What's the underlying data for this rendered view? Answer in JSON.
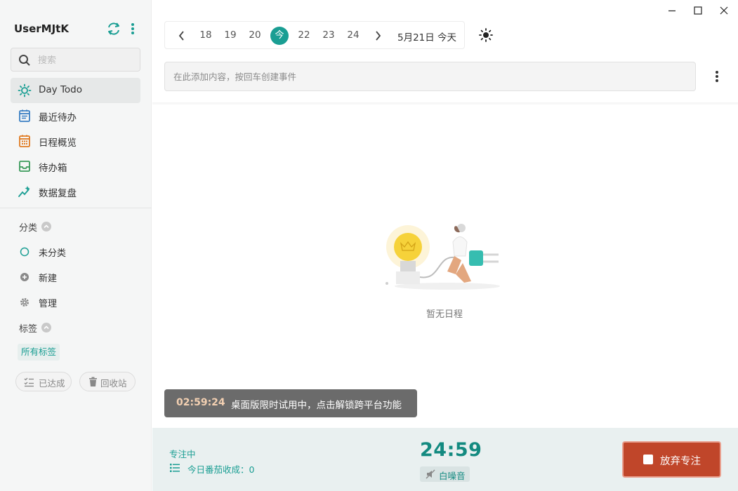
{
  "app": {
    "user_name": "UserMJtK"
  },
  "sidebar": {
    "search_placeholder": "搜索",
    "nav": [
      {
        "label": "Day Todo",
        "icon": "sun-icon",
        "active": true
      },
      {
        "label": "最近待办",
        "icon": "list-calendar-icon"
      },
      {
        "label": "日程概览",
        "icon": "calendar-grid-icon"
      },
      {
        "label": "待办箱",
        "icon": "inbox-icon"
      },
      {
        "label": "数据复盘",
        "icon": "sparkle-chart-icon"
      }
    ],
    "category_section": "分类",
    "categories": [
      {
        "label": "未分类",
        "icon": "circle-outline-icon"
      },
      {
        "label": "新建",
        "icon": "plus-circle-icon"
      },
      {
        "label": "管理",
        "icon": "gear-icon"
      }
    ],
    "tag_section": "标签",
    "all_tags": "所有标签",
    "done_button": "已达成",
    "trash_button": "回收站"
  },
  "date_bar": {
    "days": [
      "18",
      "19",
      "20",
      "22",
      "23",
      "24"
    ],
    "today_label": "今",
    "current_label": "5月21日 今天"
  },
  "add_event": {
    "placeholder": "在此添加内容，按回车创建事件"
  },
  "empty_state": {
    "text": "暂无日程"
  },
  "toast": {
    "time": "02:59:24",
    "message": "桌面版限时试用中，点击解锁跨平台功能"
  },
  "focus": {
    "status": "专注中",
    "count_text": "今日番茄收成：0",
    "timer": "24:59",
    "noise_label": "白噪音",
    "give_up_label": "放弃专注"
  },
  "colors": {
    "accent": "#1a9e93",
    "danger": "#c0462a"
  }
}
